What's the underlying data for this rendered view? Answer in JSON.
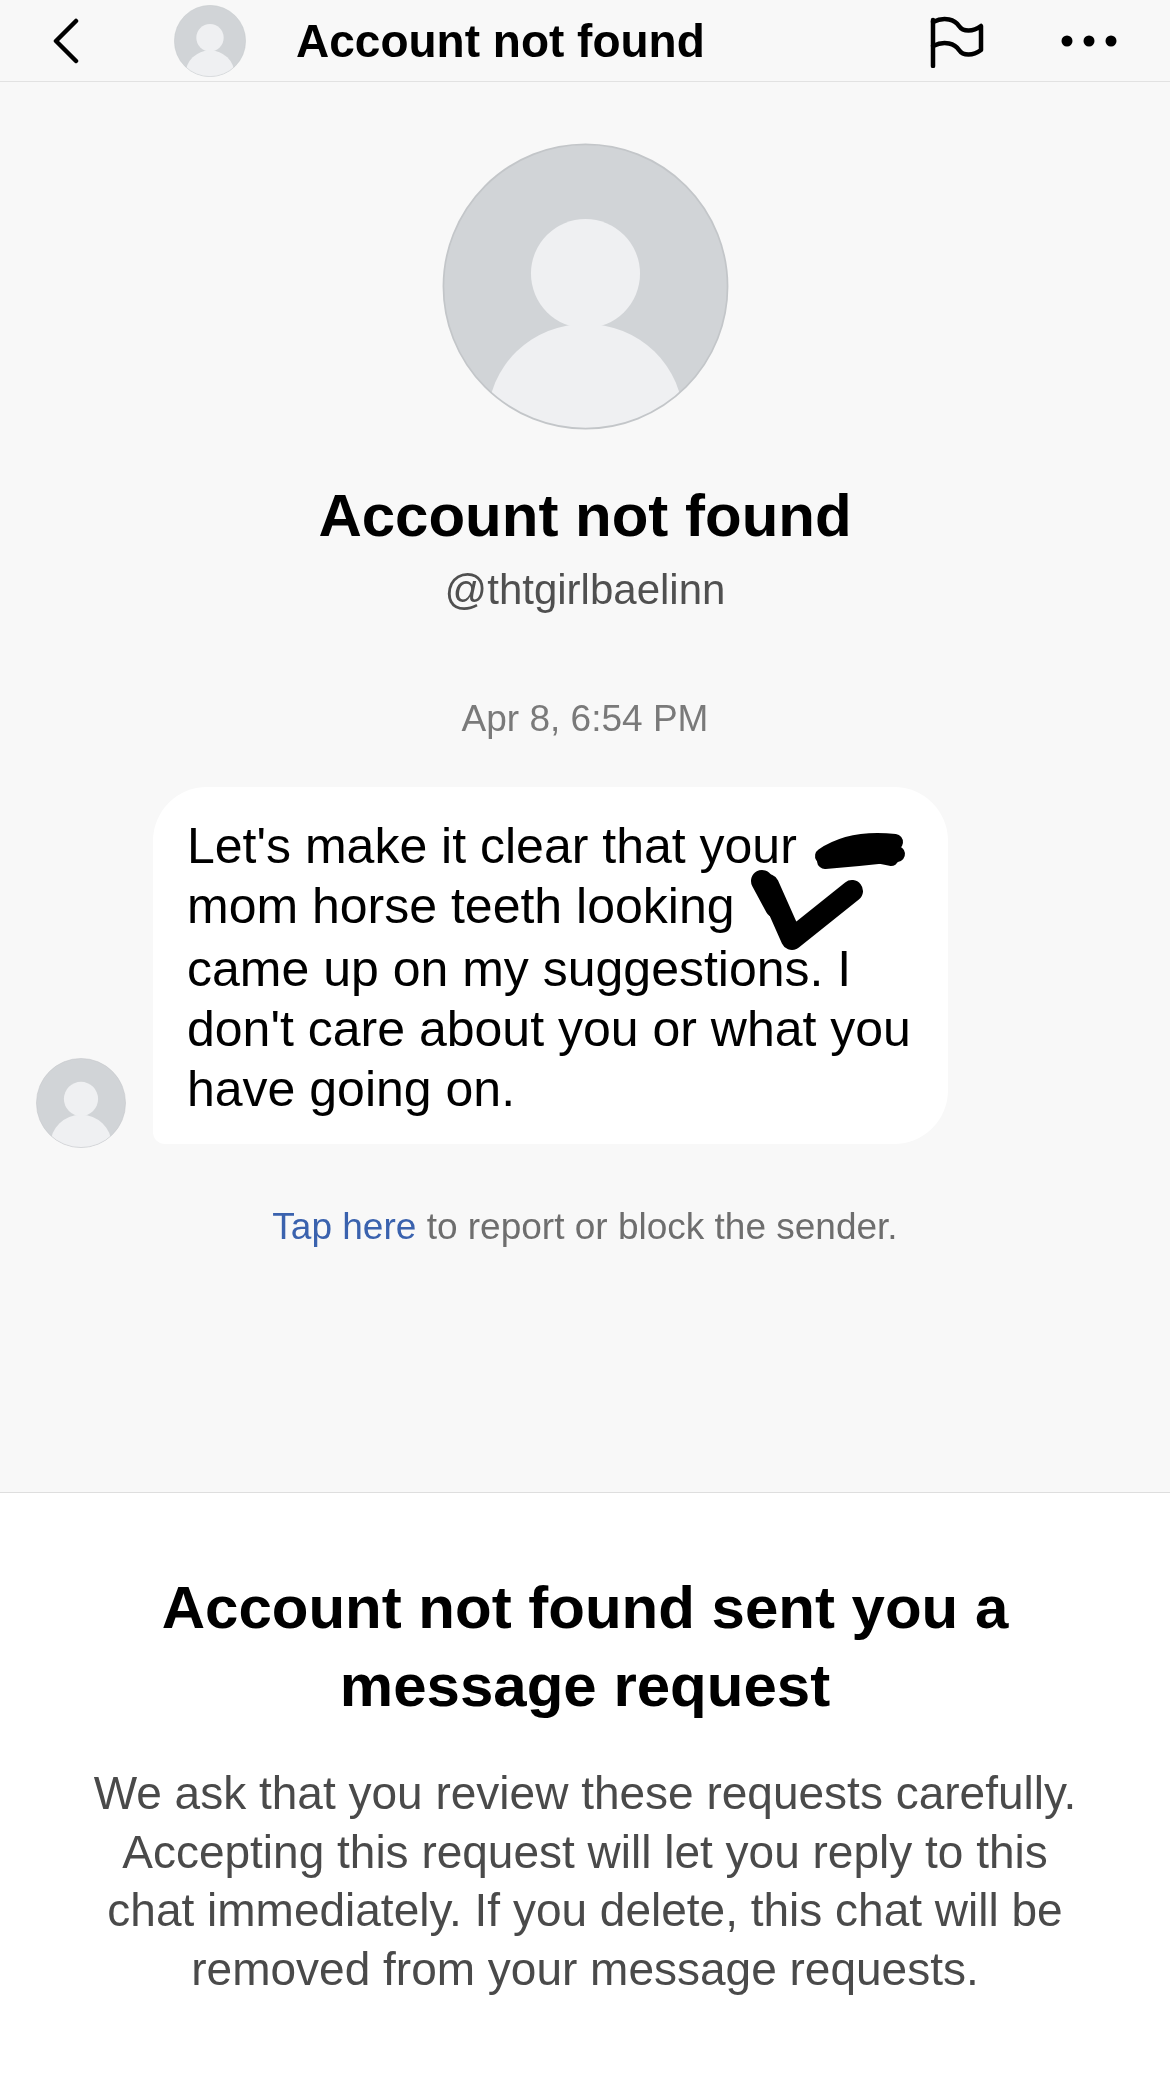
{
  "header": {
    "title": "Account not found"
  },
  "profile": {
    "name": "Account not found",
    "username": "@thtgirlbaelinn"
  },
  "conversation": {
    "timestamp": "Apr 8, 6:54 PM",
    "messages": [
      {
        "segments": [
          {
            "kind": "text",
            "text": "Let's make it clear that your"
          },
          {
            "kind": "redaction"
          },
          {
            "kind": "text",
            "text": "mom horse teeth looking"
          },
          {
            "kind": "redaction"
          },
          {
            "kind": "text",
            "text": "came up on my suggestions. I don't care about you or what you have going on."
          }
        ]
      }
    ]
  },
  "report_notice": {
    "link": "Tap here",
    "text": "to report or block the sender."
  },
  "request_panel": {
    "title": "Account not found sent you a message request",
    "body": "We ask that you review these requests carefully. Accepting this request will let you reply to this chat immediately. If you delete, this chat will be removed from your message requests."
  }
}
